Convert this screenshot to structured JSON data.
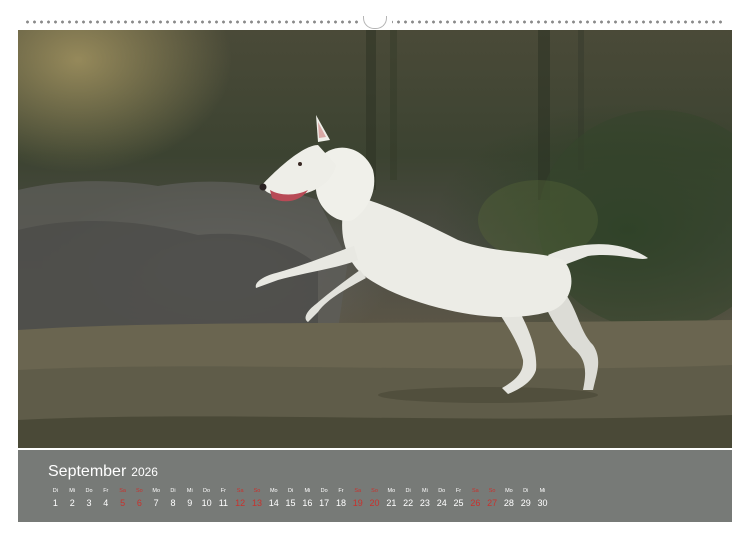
{
  "calendar": {
    "month": "September",
    "year": "2026",
    "days": [
      {
        "wd": "Di",
        "d": "1",
        "we": false
      },
      {
        "wd": "Mi",
        "d": "2",
        "we": false
      },
      {
        "wd": "Do",
        "d": "3",
        "we": false
      },
      {
        "wd": "Fr",
        "d": "4",
        "we": false
      },
      {
        "wd": "Sa",
        "d": "5",
        "we": true
      },
      {
        "wd": "So",
        "d": "6",
        "we": true
      },
      {
        "wd": "Mo",
        "d": "7",
        "we": false
      },
      {
        "wd": "Di",
        "d": "8",
        "we": false
      },
      {
        "wd": "Mi",
        "d": "9",
        "we": false
      },
      {
        "wd": "Do",
        "d": "10",
        "we": false
      },
      {
        "wd": "Fr",
        "d": "11",
        "we": false
      },
      {
        "wd": "Sa",
        "d": "12",
        "we": true
      },
      {
        "wd": "So",
        "d": "13",
        "we": true
      },
      {
        "wd": "Mo",
        "d": "14",
        "we": false
      },
      {
        "wd": "Di",
        "d": "15",
        "we": false
      },
      {
        "wd": "Mi",
        "d": "16",
        "we": false
      },
      {
        "wd": "Do",
        "d": "17",
        "we": false
      },
      {
        "wd": "Fr",
        "d": "18",
        "we": false
      },
      {
        "wd": "Sa",
        "d": "19",
        "we": true
      },
      {
        "wd": "So",
        "d": "20",
        "we": true
      },
      {
        "wd": "Mo",
        "d": "21",
        "we": false
      },
      {
        "wd": "Di",
        "d": "22",
        "we": false
      },
      {
        "wd": "Mi",
        "d": "23",
        "we": false
      },
      {
        "wd": "Do",
        "d": "24",
        "we": false
      },
      {
        "wd": "Fr",
        "d": "25",
        "we": false
      },
      {
        "wd": "Sa",
        "d": "26",
        "we": true
      },
      {
        "wd": "So",
        "d": "27",
        "we": true
      },
      {
        "wd": "Mo",
        "d": "28",
        "we": false
      },
      {
        "wd": "Di",
        "d": "29",
        "we": false
      },
      {
        "wd": "Mi",
        "d": "30",
        "we": false
      }
    ]
  },
  "colors": {
    "strip_background": "#777a77",
    "weekend": "#c8322d",
    "weekday": "#ffffff"
  },
  "photo": {
    "subject_icon": "bull-terrier-running"
  }
}
